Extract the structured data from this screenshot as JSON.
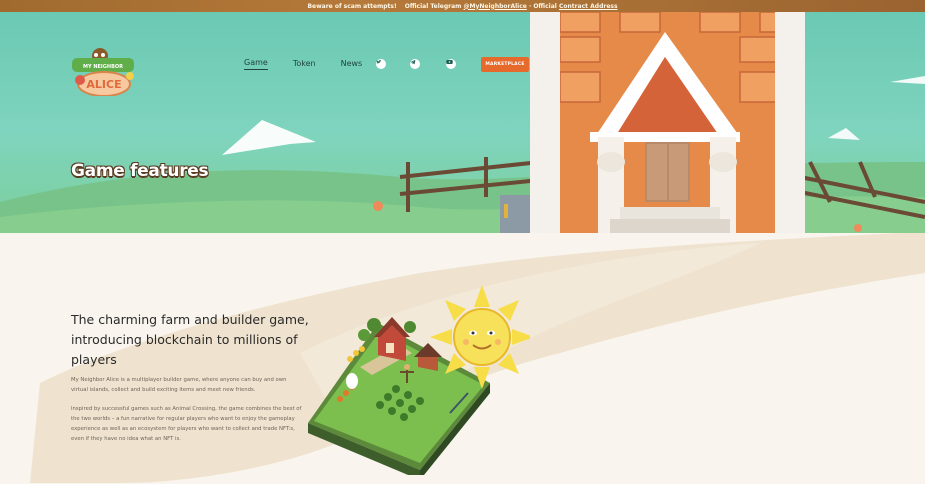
{
  "topbar": {
    "warning": "Beware of scam attempts!",
    "telegram_prefix": "Official Telegram",
    "telegram_handle": "@MyNeighborAlice",
    "separator": "· Official",
    "contract_link": "Contract Address"
  },
  "logo": {
    "line1": "MY NEIGHBOR",
    "line2": "ALICE"
  },
  "nav": {
    "items": [
      {
        "label": "Game"
      },
      {
        "label": "Token"
      },
      {
        "label": "News"
      }
    ],
    "social_icons": [
      "twitter-icon",
      "telegram-icon",
      "youtube-icon"
    ],
    "marketplace_label": "MARKETPLACE"
  },
  "hero": {
    "title": "Game features"
  },
  "main": {
    "heading": "The charming farm and builder game, introducing blockchain to millions of players",
    "paragraph1": "My Neighbor Alice is a multiplayer builder game, where anyone can buy and own virtual islands, collect and build exciting items and meet new friends.",
    "paragraph2": "Inspired by successful games such as Animal Crossing, the game combines the best of the two worlds – a fun narrative for regular players who want to enjoy the gameplay experience as well as an ecosystem for players who want to collect and trade NFT:s, even if they have no idea what an NFT is."
  },
  "colors": {
    "accent": "#e56a2c",
    "hero_sky": "#6bc9b3",
    "page_bg": "#f9f5ee"
  }
}
